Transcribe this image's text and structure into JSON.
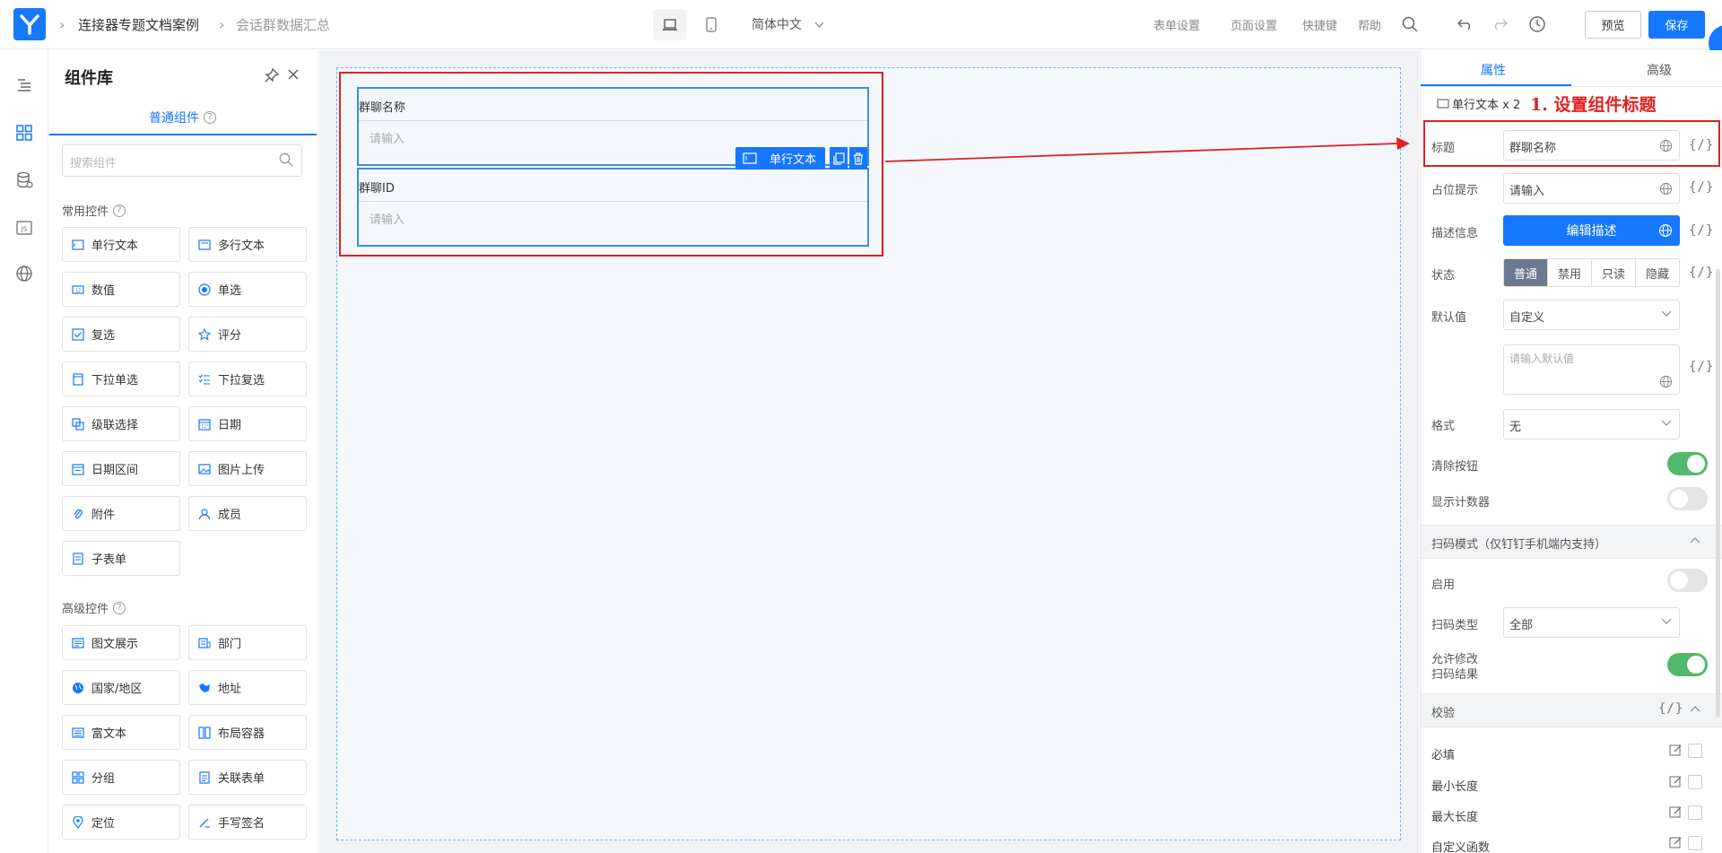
{
  "header": {
    "breadcrumb": [
      "连接器专题文档案例",
      "会话群数据汇总"
    ],
    "language": "简体中文",
    "links": [
      "表单设置",
      "页面设置",
      "快捷键",
      "帮助"
    ],
    "preview_label": "预览",
    "save_label": "保存"
  },
  "panel": {
    "title": "组件库",
    "tab": "普通组件",
    "search_placeholder": "搜索组件",
    "section_common": "常用控件",
    "common": [
      "单行文本",
      "多行文本",
      "数值",
      "单选",
      "复选",
      "评分",
      "下拉单选",
      "下拉复选",
      "级联选择",
      "日期",
      "日期区间",
      "图片上传",
      "附件",
      "成员",
      "子表单"
    ],
    "section_advanced": "高级控件",
    "advanced": [
      "图文展示",
      "部门",
      "国家/地区",
      "地址",
      "富文本",
      "布局容器",
      "分组",
      "关联表单",
      "定位",
      "手写签名"
    ]
  },
  "canvas": {
    "fields": [
      {
        "label": "群聊名称",
        "placeholder": "请输入"
      },
      {
        "label": "群聊ID",
        "placeholder": "请输入"
      }
    ],
    "selected_tag": "单行文本"
  },
  "props": {
    "tabs": [
      "属性",
      "高级"
    ],
    "crumb": "单行文本 x 2",
    "annotation": "1. 设置组件标题",
    "title_label": "标题",
    "title_value": "群聊名称",
    "placeholder_label": "占位提示",
    "placeholder_value": "请输入",
    "desc_label": "描述信息",
    "desc_button": "编辑描述",
    "state_label": "状态",
    "states": [
      "普通",
      "禁用",
      "只读",
      "隐藏"
    ],
    "default_label": "默认值",
    "default_select": "自定义",
    "default_placeholder": "请输入默认值",
    "format_label": "格式",
    "format_value": "无",
    "clear_label": "清除按钮",
    "counter_label": "显示计数器",
    "scan_section": "扫码模式（仅钉钉手机端内支持）",
    "enable_label": "启用",
    "scan_type_label": "扫码类型",
    "scan_type_value": "全部",
    "allow_edit_label_1": "允许修改",
    "allow_edit_label_2": "扫码结果",
    "validate_section": "校验",
    "rules": [
      "必填",
      "最小长度",
      "最大长度",
      "自定义函数"
    ]
  },
  "colors": {
    "accent": "#1677ff",
    "annotation": "#e02020",
    "toggle_on": "#52b86b"
  }
}
